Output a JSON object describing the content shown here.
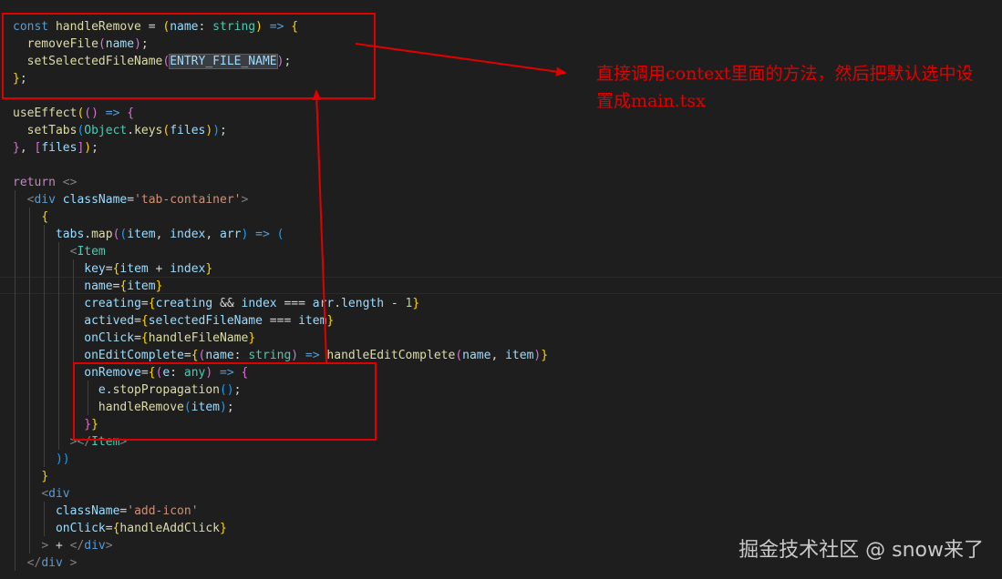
{
  "editor": {
    "lines": [
      [
        {
          "t": "const",
          "c": "kw"
        },
        {
          "t": " ",
          "c": "plain"
        },
        {
          "t": "handleRemove",
          "c": "fn"
        },
        {
          "t": " = ",
          "c": "plain"
        },
        {
          "t": "(",
          "c": "b1"
        },
        {
          "t": "name",
          "c": "var"
        },
        {
          "t": ": ",
          "c": "plain"
        },
        {
          "t": "string",
          "c": "type"
        },
        {
          "t": ")",
          "c": "b1"
        },
        {
          "t": " => ",
          "c": "kw"
        },
        {
          "t": "{",
          "c": "b1"
        }
      ],
      [
        {
          "t": "  ",
          "c": "plain"
        },
        {
          "t": "removeFile",
          "c": "fn"
        },
        {
          "t": "(",
          "c": "b2"
        },
        {
          "t": "name",
          "c": "var"
        },
        {
          "t": ")",
          "c": "b2"
        },
        {
          "t": ";",
          "c": "plain"
        }
      ],
      [
        {
          "t": "  ",
          "c": "plain"
        },
        {
          "t": "setSelectedFileName",
          "c": "fn"
        },
        {
          "t": "(",
          "c": "b2"
        },
        {
          "t": "ENTRY_FILE_NAME",
          "c": "var",
          "hl": true
        },
        {
          "t": ")",
          "c": "b2"
        },
        {
          "t": ";",
          "c": "plain"
        }
      ],
      [
        {
          "t": "}",
          "c": "b1"
        },
        {
          "t": ";",
          "c": "plain"
        }
      ],
      [],
      [
        {
          "t": "useEffect",
          "c": "fn"
        },
        {
          "t": "(",
          "c": "b1"
        },
        {
          "t": "()",
          "c": "b2"
        },
        {
          "t": " => ",
          "c": "kw"
        },
        {
          "t": "{",
          "c": "b2"
        }
      ],
      [
        {
          "t": "  ",
          "c": "plain"
        },
        {
          "t": "setTabs",
          "c": "fn"
        },
        {
          "t": "(",
          "c": "b3"
        },
        {
          "t": "Object",
          "c": "type"
        },
        {
          "t": ".",
          "c": "plain"
        },
        {
          "t": "keys",
          "c": "fn"
        },
        {
          "t": "(",
          "c": "b1"
        },
        {
          "t": "files",
          "c": "var"
        },
        {
          "t": ")",
          "c": "b1"
        },
        {
          "t": ")",
          "c": "b3"
        },
        {
          "t": ";",
          "c": "plain"
        }
      ],
      [
        {
          "t": "}",
          "c": "b2"
        },
        {
          "t": ", ",
          "c": "plain"
        },
        {
          "t": "[",
          "c": "b2"
        },
        {
          "t": "files",
          "c": "var"
        },
        {
          "t": "]",
          "c": "b2"
        },
        {
          "t": ")",
          "c": "b1"
        },
        {
          "t": ";",
          "c": "plain"
        }
      ],
      [],
      [
        {
          "t": "return",
          "c": "ctrl"
        },
        {
          "t": " ",
          "c": "plain"
        },
        {
          "t": "<>",
          "c": "tag"
        }
      ],
      [
        {
          "t": "  ",
          "c": "plain"
        },
        {
          "t": "<",
          "c": "tag"
        },
        {
          "t": "div",
          "c": "kw"
        },
        {
          "t": " ",
          "c": "plain"
        },
        {
          "t": "className",
          "c": "var"
        },
        {
          "t": "=",
          "c": "plain"
        },
        {
          "t": "'tab-container'",
          "c": "str"
        },
        {
          "t": ">",
          "c": "tag"
        }
      ],
      [
        {
          "t": "    ",
          "c": "plain"
        },
        {
          "t": "{",
          "c": "b1"
        }
      ],
      [
        {
          "t": "      ",
          "c": "plain"
        },
        {
          "t": "tabs",
          "c": "var"
        },
        {
          "t": ".",
          "c": "plain"
        },
        {
          "t": "map",
          "c": "fn"
        },
        {
          "t": "(",
          "c": "b2"
        },
        {
          "t": "(",
          "c": "b3"
        },
        {
          "t": "item",
          "c": "var"
        },
        {
          "t": ", ",
          "c": "plain"
        },
        {
          "t": "index",
          "c": "var"
        },
        {
          "t": ", ",
          "c": "plain"
        },
        {
          "t": "arr",
          "c": "var"
        },
        {
          "t": ")",
          "c": "b3"
        },
        {
          "t": " => ",
          "c": "kw"
        },
        {
          "t": "(",
          "c": "b3"
        }
      ],
      [
        {
          "t": "        ",
          "c": "plain"
        },
        {
          "t": "<",
          "c": "tag"
        },
        {
          "t": "Item",
          "c": "type"
        }
      ],
      [
        {
          "t": "          ",
          "c": "plain"
        },
        {
          "t": "key",
          "c": "var"
        },
        {
          "t": "=",
          "c": "plain"
        },
        {
          "t": "{",
          "c": "b1"
        },
        {
          "t": "item",
          "c": "var"
        },
        {
          "t": " + ",
          "c": "plain"
        },
        {
          "t": "index",
          "c": "var"
        },
        {
          "t": "}",
          "c": "b1"
        }
      ],
      [
        {
          "t": "          ",
          "c": "plain"
        },
        {
          "t": "name",
          "c": "var"
        },
        {
          "t": "=",
          "c": "plain"
        },
        {
          "t": "{",
          "c": "b1"
        },
        {
          "t": "item",
          "c": "var"
        },
        {
          "t": "}",
          "c": "b1"
        }
      ],
      [
        {
          "t": "          ",
          "c": "plain"
        },
        {
          "t": "creating",
          "c": "var"
        },
        {
          "t": "=",
          "c": "plain"
        },
        {
          "t": "{",
          "c": "b1"
        },
        {
          "t": "creating",
          "c": "var"
        },
        {
          "t": " && ",
          "c": "plain"
        },
        {
          "t": "index",
          "c": "var"
        },
        {
          "t": " === ",
          "c": "plain"
        },
        {
          "t": "arr",
          "c": "var"
        },
        {
          "t": ".",
          "c": "plain"
        },
        {
          "t": "length",
          "c": "var"
        },
        {
          "t": " - ",
          "c": "plain"
        },
        {
          "t": "1",
          "c": "num"
        },
        {
          "t": "}",
          "c": "b1"
        }
      ],
      [
        {
          "t": "          ",
          "c": "plain"
        },
        {
          "t": "actived",
          "c": "var"
        },
        {
          "t": "=",
          "c": "plain"
        },
        {
          "t": "{",
          "c": "b1"
        },
        {
          "t": "selectedFileName",
          "c": "var"
        },
        {
          "t": " === ",
          "c": "plain"
        },
        {
          "t": "item",
          "c": "var"
        },
        {
          "t": "}",
          "c": "b1"
        }
      ],
      [
        {
          "t": "          ",
          "c": "plain"
        },
        {
          "t": "onClick",
          "c": "var"
        },
        {
          "t": "=",
          "c": "plain"
        },
        {
          "t": "{",
          "c": "b1"
        },
        {
          "t": "handleFileName",
          "c": "fn"
        },
        {
          "t": "}",
          "c": "b1"
        }
      ],
      [
        {
          "t": "          ",
          "c": "plain"
        },
        {
          "t": "onEditComplete",
          "c": "var"
        },
        {
          "t": "=",
          "c": "plain"
        },
        {
          "t": "{",
          "c": "b1"
        },
        {
          "t": "(",
          "c": "b2"
        },
        {
          "t": "name",
          "c": "var"
        },
        {
          "t": ": ",
          "c": "plain"
        },
        {
          "t": "string",
          "c": "type"
        },
        {
          "t": ")",
          "c": "b2"
        },
        {
          "t": " => ",
          "c": "kw"
        },
        {
          "t": "handleEditComplete",
          "c": "fn"
        },
        {
          "t": "(",
          "c": "b2"
        },
        {
          "t": "name",
          "c": "var"
        },
        {
          "t": ", ",
          "c": "plain"
        },
        {
          "t": "item",
          "c": "var"
        },
        {
          "t": ")",
          "c": "b2"
        },
        {
          "t": "}",
          "c": "b1"
        }
      ],
      [
        {
          "t": "          ",
          "c": "plain"
        },
        {
          "t": "onRemove",
          "c": "var"
        },
        {
          "t": "=",
          "c": "plain"
        },
        {
          "t": "{",
          "c": "b1"
        },
        {
          "t": "(",
          "c": "b2"
        },
        {
          "t": "e",
          "c": "var"
        },
        {
          "t": ": ",
          "c": "plain"
        },
        {
          "t": "any",
          "c": "type"
        },
        {
          "t": ")",
          "c": "b2"
        },
        {
          "t": " => ",
          "c": "kw"
        },
        {
          "t": "{",
          "c": "b2"
        }
      ],
      [
        {
          "t": "            ",
          "c": "plain"
        },
        {
          "t": "e",
          "c": "var"
        },
        {
          "t": ".",
          "c": "plain"
        },
        {
          "t": "stopPropagation",
          "c": "fn"
        },
        {
          "t": "()",
          "c": "b3"
        },
        {
          "t": ";",
          "c": "plain"
        }
      ],
      [
        {
          "t": "            ",
          "c": "plain"
        },
        {
          "t": "handleRemove",
          "c": "fn"
        },
        {
          "t": "(",
          "c": "b3"
        },
        {
          "t": "item",
          "c": "var"
        },
        {
          "t": ")",
          "c": "b3"
        },
        {
          "t": ";",
          "c": "plain"
        }
      ],
      [
        {
          "t": "          ",
          "c": "plain"
        },
        {
          "t": "}",
          "c": "b2"
        },
        {
          "t": "}",
          "c": "b1"
        }
      ],
      [
        {
          "t": "        ",
          "c": "plain"
        },
        {
          "t": "></",
          "c": "tag"
        },
        {
          "t": "Item",
          "c": "type"
        },
        {
          "t": ">",
          "c": "tag"
        }
      ],
      [
        {
          "t": "      ",
          "c": "plain"
        },
        {
          "t": "))",
          "c": "b3"
        }
      ],
      [
        {
          "t": "    ",
          "c": "plain"
        },
        {
          "t": "}",
          "c": "b1"
        }
      ],
      [
        {
          "t": "    ",
          "c": "plain"
        },
        {
          "t": "<",
          "c": "tag"
        },
        {
          "t": "div",
          "c": "kw"
        }
      ],
      [
        {
          "t": "      ",
          "c": "plain"
        },
        {
          "t": "className",
          "c": "var"
        },
        {
          "t": "=",
          "c": "plain"
        },
        {
          "t": "'add-icon'",
          "c": "str"
        }
      ],
      [
        {
          "t": "      ",
          "c": "plain"
        },
        {
          "t": "onClick",
          "c": "var"
        },
        {
          "t": "=",
          "c": "plain"
        },
        {
          "t": "{",
          "c": "b1"
        },
        {
          "t": "handleAddClick",
          "c": "fn"
        },
        {
          "t": "}",
          "c": "b1"
        }
      ],
      [
        {
          "t": "    ",
          "c": "plain"
        },
        {
          "t": ">",
          "c": "tag"
        },
        {
          "t": " + ",
          "c": "plain"
        },
        {
          "t": "</",
          "c": "tag"
        },
        {
          "t": "div",
          "c": "kw"
        },
        {
          "t": ">",
          "c": "tag"
        }
      ],
      [
        {
          "t": "  ",
          "c": "plain"
        },
        {
          "t": "</",
          "c": "tag"
        },
        {
          "t": "div",
          "c": "kw"
        },
        {
          "t": " >",
          "c": "tag"
        }
      ]
    ]
  },
  "annotation": {
    "text": "直接调用context里面的方法，然后把默认选中设置成main.tsx",
    "color": "#e00000"
  },
  "watermark": {
    "text": "掘金技术社区 @ snow来了"
  }
}
